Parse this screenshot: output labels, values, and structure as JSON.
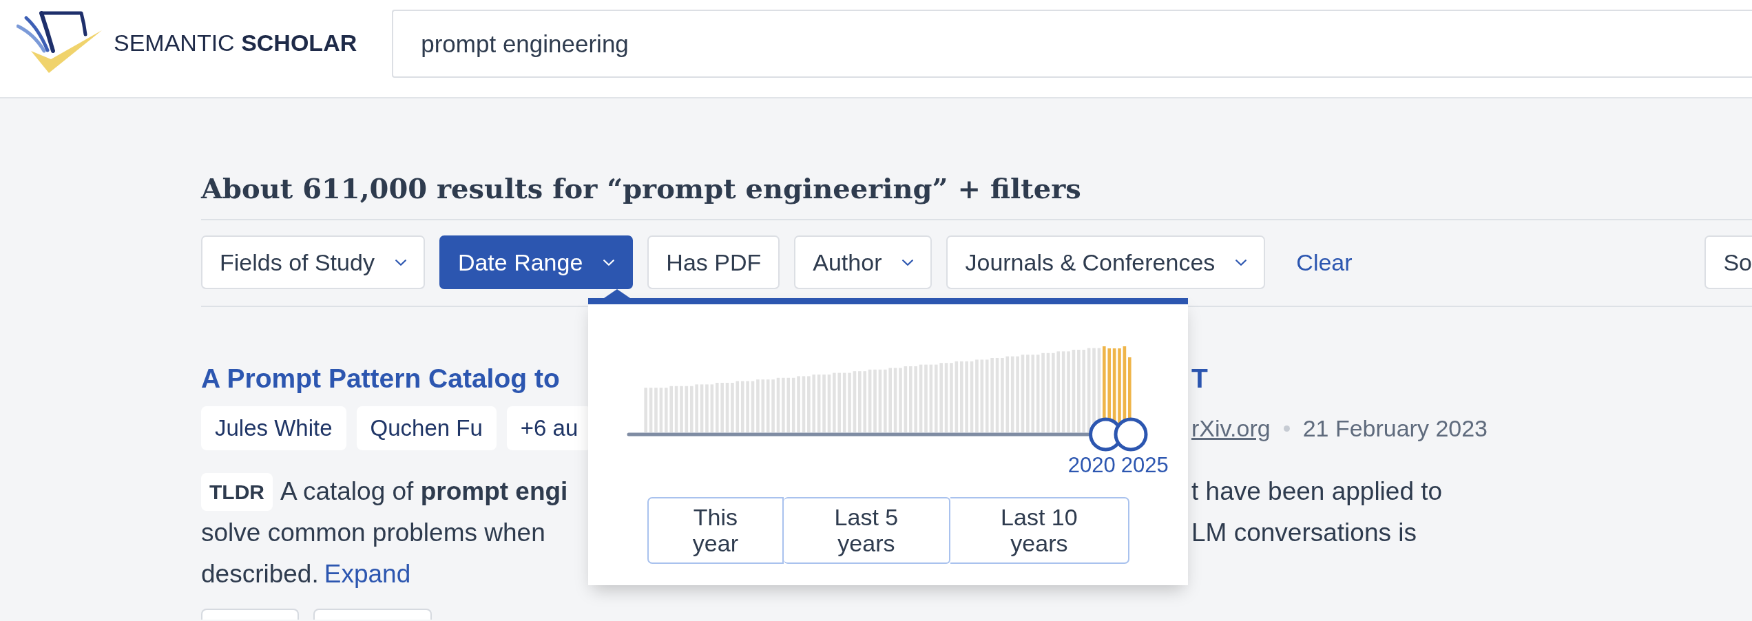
{
  "header": {
    "logo_text": "SEMANTIC **SCHOLAR**",
    "search": {
      "value": "prompt engineering"
    }
  },
  "heading": "About 611,000 results for “prompt engineering” + filters",
  "filters": [
    {
      "label": "Fields of Study",
      "kind": "dropdown",
      "expanded": false
    },
    {
      "label": "Date Range",
      "kind": "dropdown",
      "expanded": true
    },
    {
      "label": "Has PDF",
      "kind": "toggle",
      "on": false
    },
    {
      "label": "Author",
      "kind": "dropdown",
      "expanded": false
    },
    {
      "label": "Journals & Conferences",
      "kind": "dropdown",
      "expanded": false
    }
  ],
  "clear_link": "Clear",
  "sort_button": "So",
  "date_range_panel": {
    "handles": [
      {
        "label": "2020",
        "level": 0.95
      },
      {
        "label": "2025",
        "level": 1
      }
    ],
    "presets": [
      {
        "label": "This year",
        "selected": false
      },
      {
        "label": "Last 5 years",
        "selected": false
      },
      {
        "label": "Last 10 years",
        "selected": false
      }
    ]
  },
  "result": {
    "title": {
      "left": "A Prompt Pattern Catalog to",
      "right": "T"
    },
    "authors": [
      "Jules White",
      "Quchen Fu",
      "+6 au"
    ],
    "venue": "rXiv.org",
    "date": "21 February 2023",
    "tldr": {
      "label": "TLDR",
      "lines": [
        {
          "left": "A catalog of **prompt engi**",
          "right": "t have been applied to"
        },
        {
          "left": "solve common problems when",
          "right": "LM conversations is"
        },
        {
          "left": "described."
        }
      ],
      "link": "Expand"
    }
  }
}
